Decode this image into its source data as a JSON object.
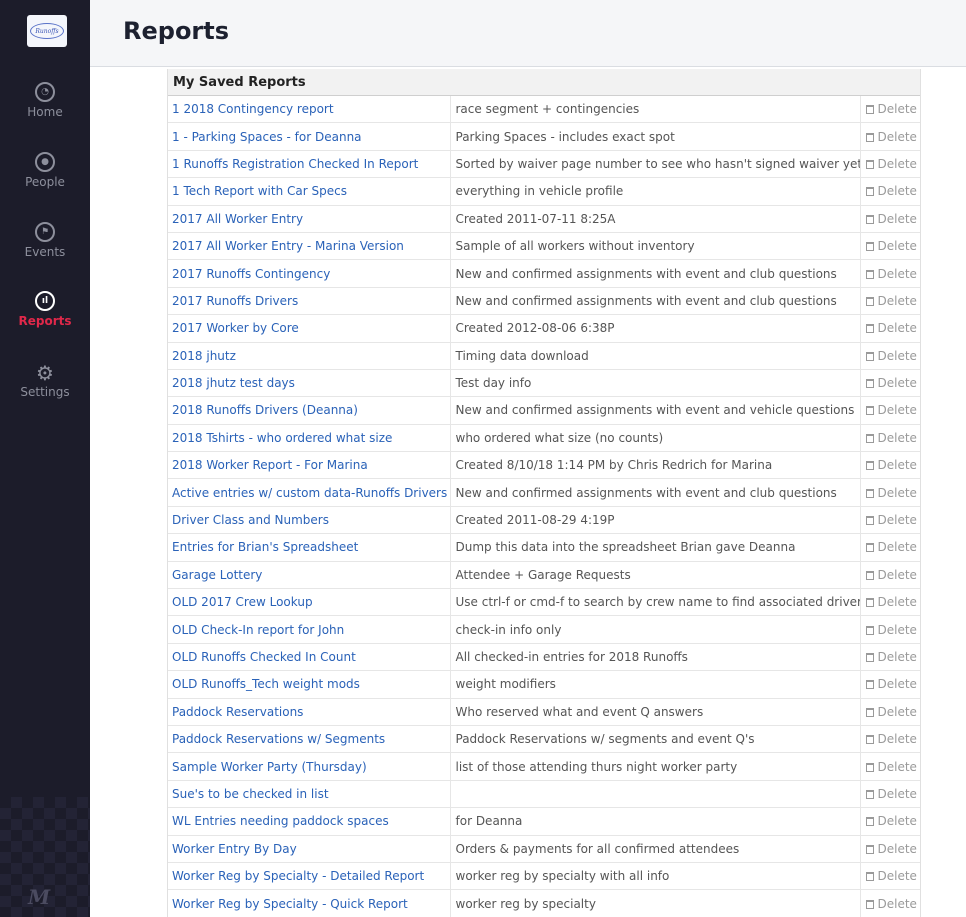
{
  "sidebar": {
    "logo_text": "Runoffs",
    "items": [
      {
        "label": "Home",
        "icon": "gauge-icon",
        "glyph": "◔"
      },
      {
        "label": "People",
        "icon": "person-icon",
        "glyph": "●"
      },
      {
        "label": "Events",
        "icon": "flag-icon",
        "glyph": "⚑"
      },
      {
        "label": "Reports",
        "icon": "bar-chart-icon",
        "glyph": "ıl"
      },
      {
        "label": "Settings",
        "icon": "gear-icon",
        "glyph": "⚙"
      }
    ],
    "bottom_logo": "M",
    "active_color": "#e0284a"
  },
  "header": {
    "title": "Reports"
  },
  "table": {
    "heading": "My Saved Reports",
    "delete_label": "Delete",
    "rows": [
      {
        "name": "1 2018 Contingency report",
        "desc": "race segment + contingencies"
      },
      {
        "name": "1 - Parking Spaces - for Deanna",
        "desc": "Parking Spaces - includes exact spot"
      },
      {
        "name": "1 Runoffs Registration Checked In Report",
        "desc": "Sorted by waiver page number to see who hasn't signed waiver yet"
      },
      {
        "name": "1 Tech Report with Car Specs",
        "desc": "everything in vehicle profile"
      },
      {
        "name": "2017 All Worker Entry",
        "desc": "Created 2011-07-11 8:25A"
      },
      {
        "name": "2017 All Worker Entry - Marina Version",
        "desc": "Sample of all workers without inventory"
      },
      {
        "name": "2017 Runoffs Contingency",
        "desc": "New and confirmed assignments with event and club questions"
      },
      {
        "name": "2017 Runoffs Drivers",
        "desc": "New and confirmed assignments with event and club questions"
      },
      {
        "name": "2017 Worker by Core",
        "desc": "Created 2012-08-06 6:38P"
      },
      {
        "name": "2018 jhutz",
        "desc": "Timing data download"
      },
      {
        "name": "2018 jhutz test days",
        "desc": "Test day info"
      },
      {
        "name": "2018 Runoffs Drivers (Deanna)",
        "desc": "New and confirmed assignments with event and vehicle questions"
      },
      {
        "name": "2018 Tshirts - who ordered what size",
        "desc": "who ordered what size (no counts)"
      },
      {
        "name": "2018 Worker Report - For Marina",
        "desc": "Created 8/10/18 1:14 PM by Chris Redrich for Marina"
      },
      {
        "name": "Active entries w/ custom data-Runoffs Drivers",
        "desc": "New and confirmed assignments with event and club questions"
      },
      {
        "name": "Driver Class and Numbers",
        "desc": "Created 2011-08-29 4:19P"
      },
      {
        "name": "Entries for Brian's Spreadsheet",
        "desc": "Dump this data into the spreadsheet Brian gave Deanna"
      },
      {
        "name": "Garage Lottery",
        "desc": "Attendee + Garage Requests"
      },
      {
        "name": "OLD 2017 Crew Lookup",
        "desc": "Use ctrl-f or cmd-f to search by crew name to find associated driver"
      },
      {
        "name": "OLD Check-In report for John",
        "desc": "check-in info only"
      },
      {
        "name": "OLD Runoffs Checked In Count",
        "desc": "All checked-in entries for 2018 Runoffs"
      },
      {
        "name": "OLD Runoffs_Tech weight mods",
        "desc": "weight modifiers"
      },
      {
        "name": "Paddock Reservations",
        "desc": "Who reserved what and event Q answers"
      },
      {
        "name": "Paddock Reservations w/ Segments",
        "desc": "Paddock Reservations w/ segments and event Q's"
      },
      {
        "name": "Sample Worker Party (Thursday)",
        "desc": "list of those attending thurs night worker party"
      },
      {
        "name": "Sue's to be checked in list",
        "desc": ""
      },
      {
        "name": "WL Entries needing paddock spaces",
        "desc": "for Deanna"
      },
      {
        "name": "Worker Entry By Day",
        "desc": "Orders & payments for all confirmed attendees"
      },
      {
        "name": "Worker Reg by Specialty - Detailed Report",
        "desc": "worker reg by specialty with all info"
      },
      {
        "name": "Worker Reg by Specialty - Quick Report",
        "desc": "worker reg by specialty"
      }
    ]
  }
}
